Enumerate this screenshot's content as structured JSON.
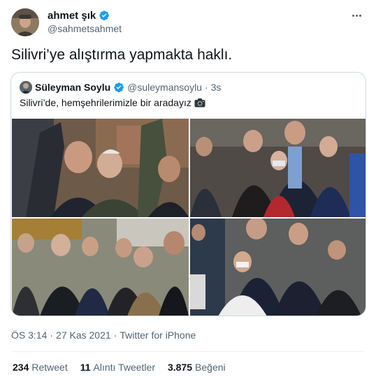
{
  "author": {
    "display_name": "ahmet şık",
    "handle": "@sahmetsahmet"
  },
  "tweet": {
    "text": "Silivri’ye alıştırma yapmakta haklı."
  },
  "quoted_tweet": {
    "display_name": "Süleyman Soylu",
    "handle": "@suleymansoylu",
    "separator": "·",
    "time": "3s",
    "text": "Silivri’de, hemşehrilerimizle bir aradayız",
    "photos": [
      {
        "icon": "crowd-selfie-photo"
      },
      {
        "icon": "group-with-children-photo"
      },
      {
        "icon": "street-group-photo"
      },
      {
        "icon": "boys-group-photo"
      }
    ]
  },
  "meta": {
    "time": "ÖS 3:14",
    "separator1": "·",
    "date": "27 Kas 2021",
    "separator2": "·",
    "source": "Twitter for iPhone"
  },
  "stats": [
    {
      "count": "234",
      "label": "Retweet"
    },
    {
      "count": "11",
      "label": "Alıntı Tweetler"
    },
    {
      "count": "3.875",
      "label": "Beğeni"
    }
  ],
  "colors": {
    "verified": "#1d9bf0",
    "text": "#0f1419",
    "secondary": "#536471",
    "border": "#cfd9de"
  }
}
